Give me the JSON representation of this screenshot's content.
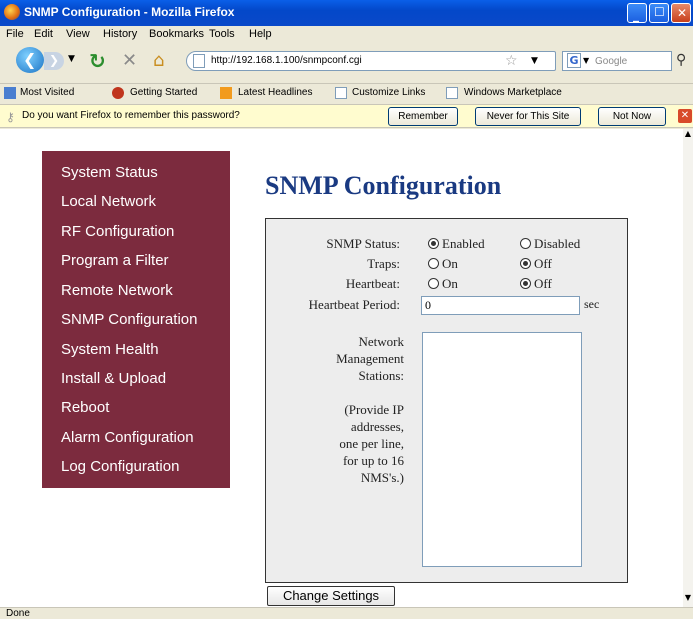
{
  "window": {
    "title": "SNMP Configuration - Mozilla Firefox"
  },
  "menu": [
    "File",
    "Edit",
    "View",
    "History",
    "Bookmarks",
    "Tools",
    "Help"
  ],
  "nav": {
    "url": "http://192.168.1.100/snmpconf.cgi",
    "search_engine": "Google"
  },
  "bookmarks": [
    "Most Visited",
    "Getting Started",
    "Latest Headlines",
    "Customize Links",
    "Windows Marketplace"
  ],
  "notification": {
    "message": "Do you want Firefox to remember this password?",
    "remember": "Remember",
    "never": "Never for This Site",
    "not_now": "Not Now"
  },
  "sidebar": [
    "System Status",
    "Local Network",
    "RF Configuration",
    "Program a Filter",
    "Remote Network",
    "SNMP Configuration",
    "System Health",
    "Install & Upload",
    "Reboot",
    "Alarm Configuration",
    "Log Configuration"
  ],
  "page": {
    "title": "SNMP Configuration",
    "snmp_status_label": "SNMP Status:",
    "snmp_enabled": "Enabled",
    "snmp_disabled": "Disabled",
    "traps_label": "Traps:",
    "traps_on": "On",
    "traps_off": "Off",
    "heartbeat_label": "Heartbeat:",
    "heartbeat_on": "On",
    "heartbeat_off": "Off",
    "heartbeat_period_label": "Heartbeat Period:",
    "heartbeat_period_value": "0",
    "heartbeat_period_unit": "sec",
    "nms_lines": [
      "Network",
      "Management",
      "Stations:",
      "",
      "(Provide IP",
      "addresses,",
      "one per line,",
      "for up to 16",
      "NMS's.)"
    ],
    "submit": "Change Settings"
  },
  "status": "Done"
}
